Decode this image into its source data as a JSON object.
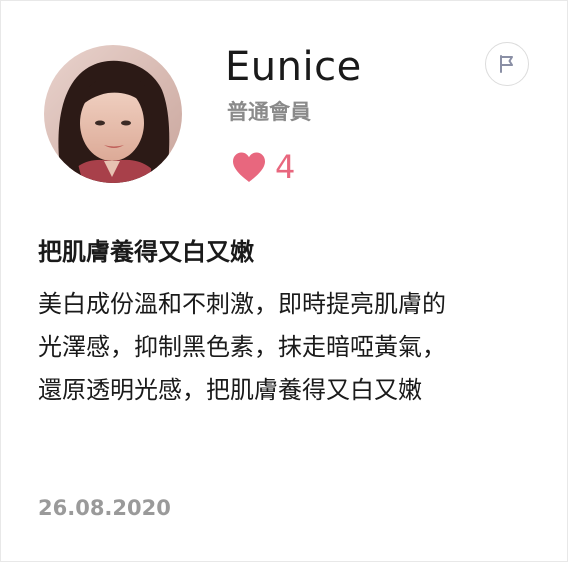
{
  "review": {
    "user": {
      "name": "Eunice",
      "member_level": "普通會員"
    },
    "likes": {
      "count": "4",
      "icon": "heart-icon",
      "color": "#e8677e"
    },
    "report_icon": "flag-icon",
    "title": "把肌膚養得又白又嫩",
    "body_lines": [
      "美白成份溫和不刺激，即時提亮肌膚的",
      "光澤感，抑制黑色素，抹走暗啞黃氣，",
      "還原透明光感，把肌膚養得又白又嫩"
    ],
    "date": "26.08.2020"
  }
}
